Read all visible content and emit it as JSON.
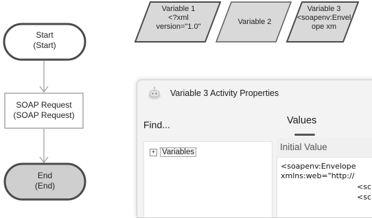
{
  "flow": {
    "start": {
      "line1": "Start",
      "line2": "(Start)"
    },
    "soap": {
      "line1": "SOAP Request",
      "line2": "(SOAP Request)"
    },
    "end": {
      "line1": "End",
      "line2": "(End)"
    }
  },
  "variables": [
    {
      "label": "Variable 1\n<?xml\nversion=\"1.0\""
    },
    {
      "label": "Variable 2"
    },
    {
      "label": "Variable 3\n<soapenv:Envel\nope xm"
    }
  ],
  "dialog": {
    "title": "Variable 3 Activity Properties",
    "find_label": "Find...",
    "tree_expander": "+",
    "tree_item": "Variables",
    "values_tab": "Values",
    "initial_value_header": "Initial Value",
    "value_lines": [
      "<soapenv:Envelope",
      "xmlns:web=\"http://",
      "<sc",
      "<sc"
    ]
  },
  "colors": {
    "node_fill": "#d9d9d9",
    "node_stroke": "#5a5a5a",
    "terminal_border": "#4a4a4a",
    "accent_connector": "#9a9a9a"
  }
}
